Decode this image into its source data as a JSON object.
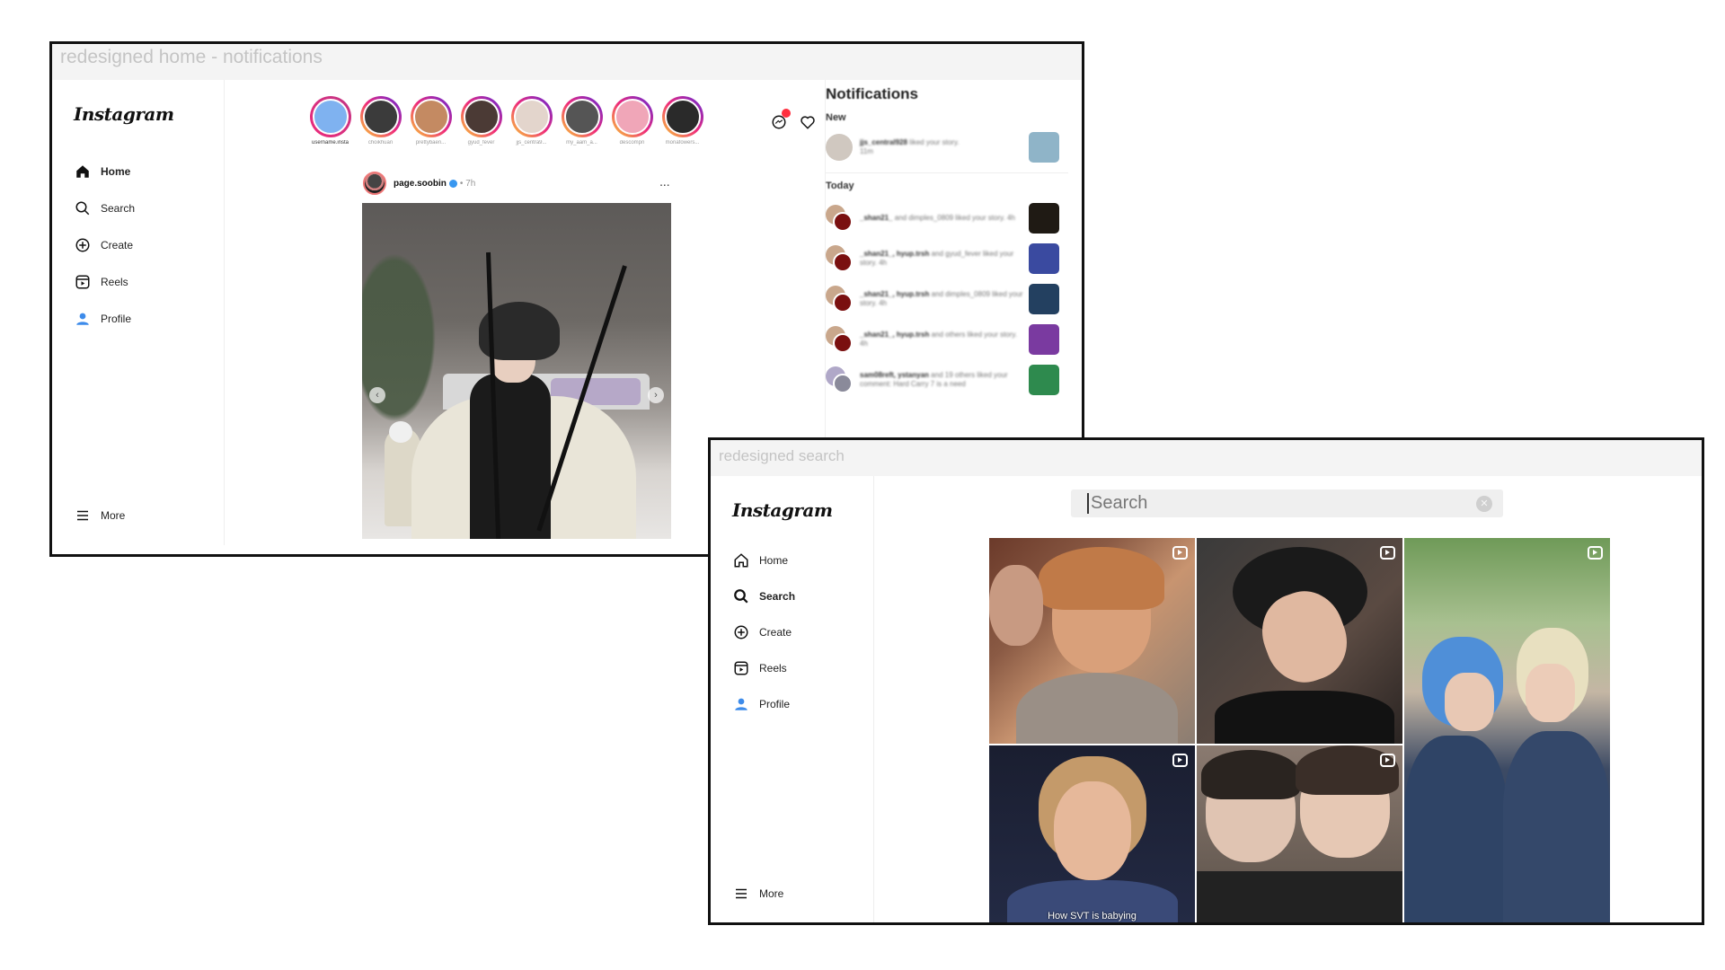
{
  "home_frame": {
    "title": "redesigned home - notifications",
    "logo": "Instagram",
    "nav": [
      {
        "label": "Home",
        "icon": "home-icon"
      },
      {
        "label": "Search",
        "icon": "search-icon"
      },
      {
        "label": "Create",
        "icon": "create-icon"
      },
      {
        "label": "Reels",
        "icon": "reels-icon"
      },
      {
        "label": "Profile",
        "icon": "profile-icon"
      }
    ],
    "more_label": "More",
    "stories": [
      {
        "name": "username.insta",
        "color": "#7fb2f0"
      },
      {
        "name": "choikhuan",
        "color": "#3b3b3b"
      },
      {
        "name": "prettybaen...",
        "color": "#c48a62"
      },
      {
        "name": "gyud_fever",
        "color": "#4b3a35"
      },
      {
        "name": "jjs_centra9...",
        "color": "#e3d5cc"
      },
      {
        "name": "my_aam_a...",
        "color": "#555555"
      },
      {
        "name": "descompn",
        "color": "#f0a6b8"
      },
      {
        "name": "monafowers...",
        "color": "#2a2a2a"
      }
    ],
    "post": {
      "username": "page.soobin",
      "time": "7h",
      "more": "..."
    },
    "notifications": {
      "title": "Notifications",
      "sections": [
        "New",
        "Today"
      ],
      "new": [
        {
          "user": "jjs_central928",
          "text": "liked your story.",
          "time": "11m",
          "thumb": "#8fb4c8"
        }
      ],
      "today": [
        {
          "user": "_shan21_",
          "text": "and dimples_0809 liked your story. 4h",
          "thumb": "#1f1a14"
        },
        {
          "user": "_shan21_, hyup.trsh",
          "text": "and gyud_fever liked your story. 4h",
          "thumb": "#3a4aa0"
        },
        {
          "user": "_shan21_, hyup.trsh",
          "text": "and dimples_0809 liked your story. 4h",
          "thumb": "#234060"
        },
        {
          "user": "_shan21_, hyup.trsh",
          "text": "and others liked your story. 4h",
          "thumb": "#7a3aa0"
        },
        {
          "user": "sam08reft, ystanyan",
          "text": "and 19 others liked your comment: Hard Carry 7 is a need",
          "thumb": "#2e8a4e"
        }
      ]
    }
  },
  "search_frame": {
    "title": "redesigned search",
    "logo": "Instagram",
    "nav": [
      {
        "label": "Home",
        "icon": "home-icon"
      },
      {
        "label": "Search",
        "icon": "search-icon"
      },
      {
        "label": "Create",
        "icon": "create-icon"
      },
      {
        "label": "Reels",
        "icon": "reels-icon"
      },
      {
        "label": "Profile",
        "icon": "profile-icon"
      }
    ],
    "more_label": "More",
    "search_placeholder": "Search",
    "grid": [
      {
        "type": "reel",
        "colors": [
          "#6b3a2a",
          "#c89470",
          "#8a7d72"
        ]
      },
      {
        "type": "reel",
        "colors": [
          "#3a3a3a",
          "#5a4a42",
          "#121212"
        ]
      },
      {
        "type": "reel",
        "colors": [
          "#6f9a58",
          "#4f8fd8",
          "#2c3e5a"
        ]
      },
      {
        "type": "reel",
        "colors": [
          "#1a1e30",
          "#d9a888",
          "#3a4a78"
        ],
        "caption": "How SVT is babying"
      },
      {
        "type": "reel",
        "colors": [
          "#8a7a70",
          "#e0c4b2",
          "#222222"
        ]
      }
    ]
  }
}
